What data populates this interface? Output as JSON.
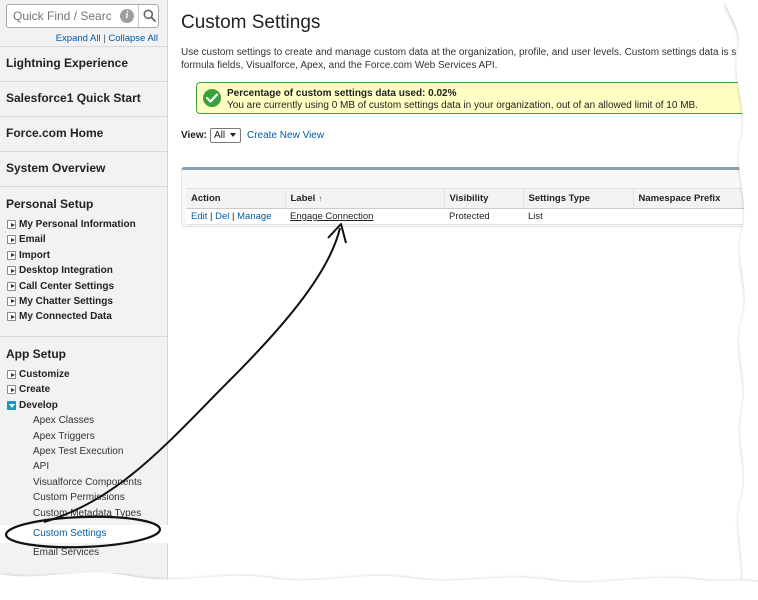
{
  "sidebar": {
    "search_placeholder": "Quick Find / Search...",
    "expand_all": "Expand All",
    "separator": "|",
    "collapse_all": "Collapse All",
    "lightning": "Lightning Experience",
    "sf1": "Salesforce1 Quick Start",
    "forcecom": "Force.com Home",
    "overview": "System Overview",
    "personal_setup": {
      "title": "Personal Setup",
      "items": [
        "My Personal Information",
        "Email",
        "Import",
        "Desktop Integration",
        "Call Center Settings",
        "My Chatter Settings",
        "My Connected Data"
      ]
    },
    "app_setup": {
      "title": "App Setup",
      "customize": "Customize",
      "create": "Create",
      "develop": "Develop",
      "develop_children": [
        "Apex Classes",
        "Apex Triggers",
        "Apex Test Execution",
        "API",
        "Visualforce Components",
        "Custom Permissions",
        "Custom Metadata Types",
        "Custom Settings",
        "Email Services"
      ]
    }
  },
  "main": {
    "title": "Custom Settings",
    "description_line1": "Use custom settings to create and manage custom data at the organization, profile, and user levels. Custom settings data is s",
    "description_line2": "formula fields, Visualforce, Apex, and the Force.com Web Services API.",
    "usage_title": "Percentage of custom settings data used: 0.02%",
    "usage_text": "You are currently using 0 MB of custom settings data in your organization, out of an allowed limit of 10 MB.",
    "view_label": "View:",
    "view_value": "All",
    "create_view": "Create New View",
    "table": {
      "headers": [
        "Action",
        "Label",
        "Visibility",
        "Settings Type",
        "Namespace Prefix"
      ],
      "sort_icon": "↑",
      "rows": [
        {
          "edit": "Edit",
          "del": "Del",
          "manage": "Manage",
          "sep": "|",
          "label": "Engage Connection",
          "visibility": "Protected",
          "type": "List",
          "prefix": ""
        }
      ]
    }
  },
  "colors": {
    "link": "#015ba7",
    "success": "#3aa13a",
    "info_bg": "#ffffc4",
    "sidebar_bg": "#f2f2f2"
  }
}
